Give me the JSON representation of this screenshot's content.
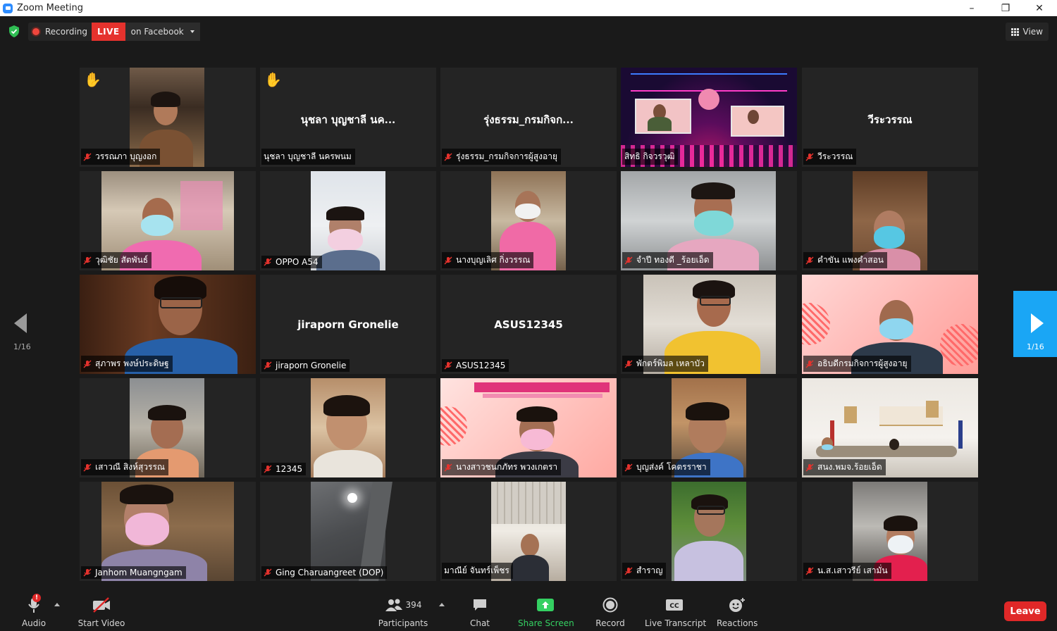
{
  "window": {
    "title": "Zoom Meeting",
    "controls": [
      "–",
      "❐",
      "✕"
    ]
  },
  "topbar": {
    "recording_label": "Recording",
    "live_badge": "LIVE",
    "live_target": "on Facebook",
    "view_label": "View"
  },
  "tiles": [
    {
      "name": "วรรณภา บุญงอก",
      "raised_hand": true,
      "mic_muted": true
    },
    {
      "name": "นุชลา บุญชาลี นครพนม",
      "display": "นุชลา บุญชาลี นค...",
      "raised_hand": true,
      "mic_muted": false
    },
    {
      "name": "รุ่งธรรม_กรมกิจการผู้สูงอายุ",
      "display": "รุ่งธรรม_กรมกิจก...",
      "mic_muted": true
    },
    {
      "name": "สิทธิ กิจวรวุฒิ",
      "active_speaker": true,
      "mic_muted": false
    },
    {
      "name": "วีระวรรณ",
      "display": "วีระวรรณ",
      "mic_muted": true
    },
    {
      "name": "วุฒิชัย สัตพันธ์",
      "mic_muted": true
    },
    {
      "name": "OPPO A54",
      "mic_muted": true
    },
    {
      "name": "นางบุญเลิศ กิ่งวรรณ",
      "mic_muted": true
    },
    {
      "name": "จำปี ทองดี _ร้อยเอ็ด",
      "mic_muted": true
    },
    {
      "name": "คำขัน แพงคำสอน",
      "mic_muted": true
    },
    {
      "name": "สุภาพร พงษ์ประดิษฐ",
      "mic_muted": true
    },
    {
      "name": "jiraporn Gronelie",
      "display": "jiraporn Gronelie",
      "mic_muted": true
    },
    {
      "name": "ASUS12345",
      "display": "ASUS12345",
      "mic_muted": true
    },
    {
      "name": "พักตร์พิมล เหลาบัว",
      "mic_muted": true
    },
    {
      "name": "อธิบดีกรมกิจการผู้สูงอายุ",
      "mic_muted": true
    },
    {
      "name": "เสาวณี สิงห์สุวรรณ",
      "mic_muted": true
    },
    {
      "name": "12345",
      "mic_muted": true
    },
    {
      "name": "นางสาวชนกภัทร พวงเกตรา",
      "mic_muted": true
    },
    {
      "name": "บุญส่งค์ โคตรราชา",
      "mic_muted": true
    },
    {
      "name": "สนง.พมจ.ร้อยเอ็ด",
      "mic_muted": true
    },
    {
      "name": "Janhom Muangngam",
      "mic_muted": true
    },
    {
      "name": "Ging Charuangreet (DOP)",
      "mic_muted": true
    },
    {
      "name": "มาณีย์ จันทร์เพ็ชร",
      "mic_muted": false
    },
    {
      "name": "สำราญ",
      "mic_muted": true
    },
    {
      "name": "น.ส.เสาวรีย์ เสามั่น",
      "mic_muted": true
    }
  ],
  "pagination": {
    "left": "1/16",
    "right": "1/16"
  },
  "toolbar": {
    "audio": "Audio",
    "audio_alert": "!",
    "start_video": "Start Video",
    "participants": "Participants",
    "participant_count": "394",
    "chat": "Chat",
    "share_screen": "Share Screen",
    "record": "Record",
    "live_transcript": "Live Transcript",
    "reactions": "Reactions",
    "leave": "Leave",
    "cc_text": "CC"
  },
  "colors": {
    "accent_green": "#34d062",
    "live_red": "#e5322d",
    "leave_red": "#e02828",
    "active_speaker": "#c7e15f",
    "page_next_blue": "#1aa6f5"
  }
}
